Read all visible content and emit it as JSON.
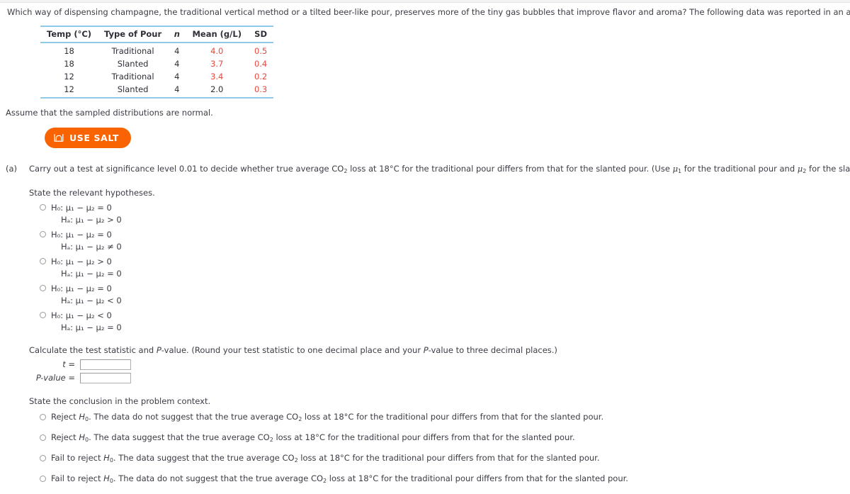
{
  "intro": {
    "text": "Which way of dispensing champagne, the traditional vertical method or a tilted beer-like pour, preserves more of the tiny gas bubbles that improve flavor and aroma? The following data was reported in an article."
  },
  "table": {
    "headers": [
      "Temp (°C)",
      "Type of Pour",
      "n",
      "Mean (g/L)",
      "SD"
    ],
    "rows": [
      {
        "temp": "18",
        "pour": "Traditional",
        "n": "4",
        "mean": "4.0",
        "sd": "0.5",
        "mean_color": "#e8483c",
        "sd_color": "#e8483c"
      },
      {
        "temp": "18",
        "pour": "Slanted",
        "n": "4",
        "mean": "3.7",
        "sd": "0.4",
        "mean_color": "#e8483c",
        "sd_color": "#e8483c"
      },
      {
        "temp": "12",
        "pour": "Traditional",
        "n": "4",
        "mean": "3.4",
        "sd": "0.2",
        "mean_color": "#e8483c",
        "sd_color": "#e8483c"
      },
      {
        "temp": "12",
        "pour": "Slanted",
        "n": "4",
        "mean": "2.0",
        "sd": "0.3",
        "mean_color": "#2f2f38",
        "sd_color": "#e8483c"
      }
    ],
    "border_color": "#8ecbe8"
  },
  "assume_note": "Assume that the sampled distributions are normal.",
  "salt_button": {
    "label": "USE SALT",
    "icon": "distribution-curve-icon",
    "bg_color": "#f96302",
    "text_color": "#ffffff"
  },
  "part_a": {
    "label": "(a)",
    "question_prefix": "Carry out a test at significance level 0.01 to decide whether true average CO",
    "question_mid": " loss at 18°C for the traditional pour differs from that for the slanted pour. (Use ",
    "question_mu1": "μ",
    "question_mu1_sub": "1",
    "question_mid2": " for the traditional pour and ",
    "question_mu2": "μ",
    "question_mu2_sub": "2",
    "question_suffix": " for the slanted pour.)",
    "chem_sub": "2",
    "hypotheses_heading": "State the relevant hypotheses.",
    "hypotheses": [
      {
        "null": "H₀: μ₁ − μ₂ = 0",
        "alt": "Hₐ: μ₁ − μ₂ > 0",
        "null_rel": "=",
        "alt_rel": ">",
        "selected": false
      },
      {
        "null": "H₀: μ₁ − μ₂ = 0",
        "alt": "Hₐ: μ₁ − μ₂ ≠ 0",
        "null_rel": "=",
        "alt_rel": "≠",
        "selected": false
      },
      {
        "null": "H₀: μ₁ − μ₂ > 0",
        "alt": "Hₐ: μ₁ − μ₂ = 0",
        "null_rel": ">",
        "alt_rel": "=",
        "selected": false
      },
      {
        "null": "H₀: μ₁ − μ₂ = 0",
        "alt": "Hₐ: μ₁ − μ₂ < 0",
        "null_rel": "=",
        "alt_rel": "<",
        "selected": false
      },
      {
        "null": "H₀: μ₁ − μ₂ < 0",
        "alt": "Hₐ: μ₁ − μ₂ = 0",
        "null_rel": "<",
        "alt_rel": "=",
        "selected": false
      }
    ],
    "calculate_instruction_1": "Calculate the test statistic and ",
    "calculate_instruction_2": "-value. (Round your test statistic to one decimal place and your ",
    "calculate_instruction_3": "-value to three decimal places.)",
    "p_italic": "P",
    "inputs": [
      {
        "label_main": "t",
        "label_eq": " =",
        "value": "",
        "placeholder": ""
      },
      {
        "label_main": "P-value",
        "label_eq": " =",
        "value": "",
        "placeholder": ""
      }
    ],
    "conclusion_heading": "State the conclusion in the problem context.",
    "conclusions": [
      {
        "decision": "Reject ",
        "h0": "H",
        "h0_sub": "0",
        "body_1": ". The data do not suggest that the true average CO",
        "chem_sub": "2",
        "body_2": " loss at 18°C for the traditional pour differs from that for the slanted pour.",
        "selected": false
      },
      {
        "decision": "Reject ",
        "h0": "H",
        "h0_sub": "0",
        "body_1": ". The data suggest that the true average CO",
        "chem_sub": "2",
        "body_2": " loss at 18°C for the traditional pour differs from that for the slanted pour.",
        "selected": false
      },
      {
        "decision": "Fail to reject ",
        "h0": "H",
        "h0_sub": "0",
        "body_1": ". The data suggest that the true average CO",
        "chem_sub": "2",
        "body_2": " loss at 18°C for the traditional pour differs from that for the slanted pour.",
        "selected": false
      },
      {
        "decision": "Fail to reject ",
        "h0": "H",
        "h0_sub": "0",
        "body_1": ". The data do not suggest that the true average CO",
        "chem_sub": "2",
        "body_2": " loss at 18°C for the traditional pour differs from that for the slanted pour.",
        "selected": false
      }
    ]
  }
}
